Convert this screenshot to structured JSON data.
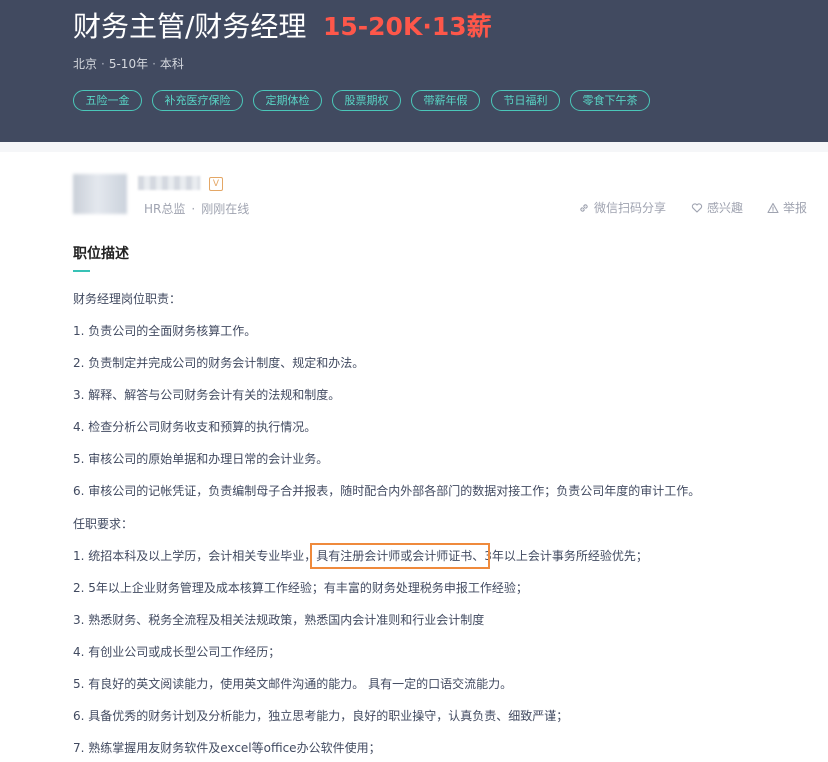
{
  "job": {
    "title": "财务主管/财务经理",
    "salary": "15-20K·13薪",
    "city": "北京",
    "experience": "5-10年",
    "degree": "本科",
    "separator": "·"
  },
  "tags": [
    "五险一金",
    "补充医疗保险",
    "定期体检",
    "股票期权",
    "带薪年假",
    "节日福利",
    "零食下午茶"
  ],
  "recruiter": {
    "badge": "V",
    "role": "HR总监",
    "dot": "·",
    "status": "刚刚在线"
  },
  "actions": {
    "share": "微信扫码分享",
    "interest": "感兴趣",
    "report": "举报"
  },
  "section_title": "职位描述",
  "duties_heading": "财务经理岗位职责：",
  "duties": [
    "1. 负责公司的全面财务核算工作。",
    "2. 负责制定并完成公司的财务会计制度、规定和办法。",
    "3. 解释、解答与公司财务会计有关的法规和制度。",
    "4. 检查分析公司财务收支和预算的执行情况。",
    "5. 审核公司的原始单据和办理日常的会计业务。",
    "6. 审核公司的记帐凭证，负责编制母子合并报表，随时配合内外部各部门的数据对接工作；负责公司年度的审计工作。"
  ],
  "requirements_heading": "任职要求：",
  "requirement_1": {
    "before": "1. 统招本科及以上学历，会计相关专业毕业，",
    "highlight": "具有注册会计师或会计师证书、",
    "after": "3年以上会计事务所经验优先；"
  },
  "requirements": [
    "2. 5年以上企业财务管理及成本核算工作经验；有丰富的财务处理税务申报工作经验；",
    "3. 熟悉财务、税务全流程及相关法规政策，熟悉国内会计准则和行业会计制度",
    "4. 有创业公司或成长型公司工作经历；",
    "5. 有良好的英文阅读能力，使用英文邮件沟通的能力。 具有一定的口语交流能力。",
    "6. 具备优秀的财务计划及分析能力，独立思考能力，良好的职业操守，认真负责、细致严谨；",
    "7. 熟练掌握用友财务软件及excel等office办公软件使用；"
  ],
  "colors": {
    "banner": "#414a60",
    "salary": "#fe574a",
    "tag": "#59d4c5",
    "accent": "#38c2b6",
    "highlight_box": "#ef8a3c"
  },
  "icons": {
    "share": "link-icon",
    "interest": "heart-icon",
    "report": "warning-icon"
  }
}
